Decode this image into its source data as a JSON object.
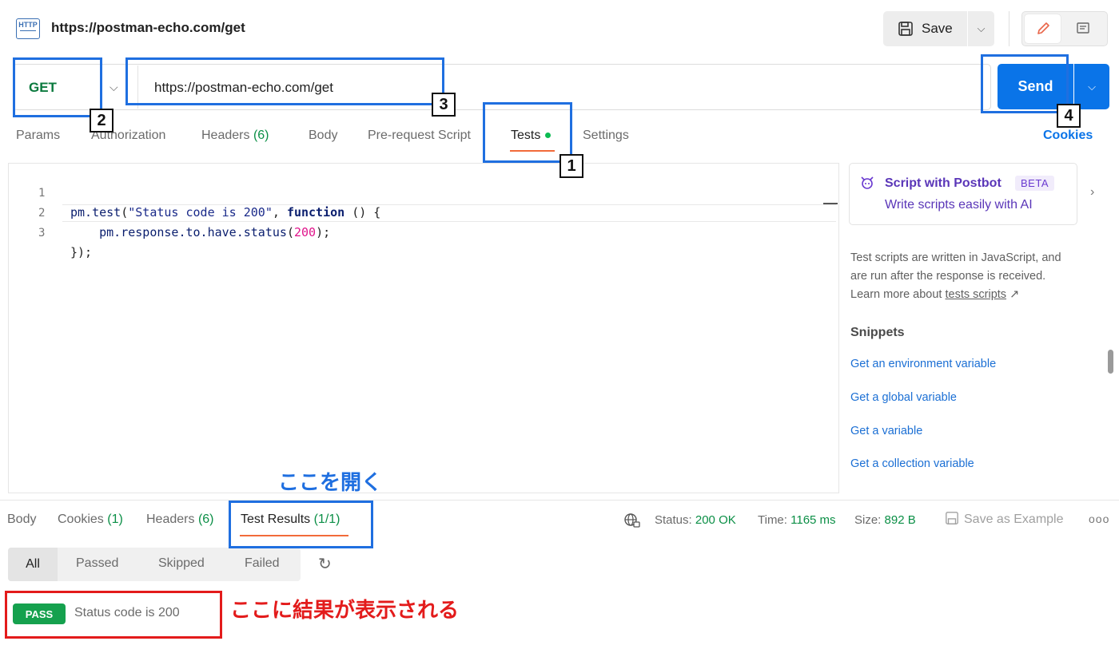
{
  "header": {
    "http_icon": "HTTP",
    "title": "https://postman-echo.com/get",
    "save_label": "Save"
  },
  "request": {
    "method": "GET",
    "url": "https://postman-echo.com/get",
    "send_label": "Send"
  },
  "request_tabs": {
    "params": "Params",
    "authorization": "Authorization",
    "headers": "Headers",
    "headers_count": "(6)",
    "body": "Body",
    "prerequest": "Pre-request Script",
    "tests": "Tests",
    "settings": "Settings",
    "cookies": "Cookies"
  },
  "editor": {
    "line_numbers": [
      "1",
      "2",
      "3"
    ]
  },
  "right_panel": {
    "postbot_title": "Script with Postbot",
    "postbot_badge": "BETA",
    "postbot_sub": "Write scripts easily with AI",
    "info_1": "Test scripts are written in JavaScript, and",
    "info_2": "are run after the response is received.",
    "info_3_prefix": "Learn more about ",
    "info_3_link": "tests scripts",
    "info_3_arrow": "↗",
    "snippets_heading": "Snippets",
    "snippets": [
      "Get an environment variable",
      "Get a global variable",
      "Get a variable",
      "Get a collection variable"
    ]
  },
  "response_tabs": {
    "body": "Body",
    "cookies": "Cookies",
    "cookies_count": "(1)",
    "headers": "Headers",
    "headers_count": "(6)",
    "test_results": "Test Results",
    "test_results_count": "(1/1)"
  },
  "response_meta": {
    "status_label": "Status:",
    "status_value": "200 OK",
    "time_label": "Time:",
    "time_value": "1165 ms",
    "size_label": "Size:",
    "size_value": "892 B",
    "save_example": "Save as Example",
    "more": "ooo"
  },
  "filters": {
    "all": "All",
    "passed": "Passed",
    "skipped": "Skipped",
    "failed": "Failed"
  },
  "result": {
    "badge": "PASS",
    "text": "Status code is 200"
  },
  "annotations": {
    "n1": "1",
    "n2": "2",
    "n3": "3",
    "n4": "4",
    "open_here": "ここを開く",
    "result_here": "ここに結果が表示される"
  },
  "colors": {
    "accent_blue": "#0a74e8",
    "method_green": "#0b7a3e",
    "tab_underline": "#f26b3a",
    "pass_green": "#15a14e",
    "annotation_blue": "#1f6fe0",
    "annotation_red": "#e31b1b"
  }
}
